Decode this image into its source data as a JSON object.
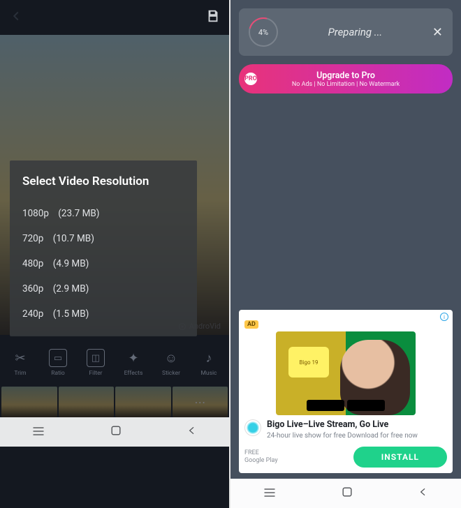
{
  "left": {
    "resolution_title": "Select Video Resolution",
    "options": [
      {
        "label": "1080p",
        "size": "(23.7 MB)"
      },
      {
        "label": "720p",
        "size": "(10.7 MB)"
      },
      {
        "label": "480p",
        "size": "(4.9 MB)"
      },
      {
        "label": "360p",
        "size": "(2.9 MB)"
      },
      {
        "label": "240p",
        "size": "(1.5 MB)"
      }
    ],
    "watermark": "AndroVid",
    "tools": [
      {
        "label": "Trim",
        "glyph": "✂"
      },
      {
        "label": "Ratio",
        "glyph": "▭"
      },
      {
        "label": "Filter",
        "glyph": "◫"
      },
      {
        "label": "Effects",
        "glyph": "✦"
      },
      {
        "label": "Sticker",
        "glyph": "☺"
      },
      {
        "label": "Music",
        "glyph": "♪"
      }
    ]
  },
  "right": {
    "progress_percent": "4%",
    "progress_label": "Preparing ...",
    "upgrade_badge": "PRO",
    "upgrade_title": "Upgrade to Pro",
    "upgrade_sub": "No Ads | No Limitation | No Watermark",
    "ad_tag": "AD",
    "ad_bubble": "Bigo 19",
    "ad_title": "Bigo Live–Live Stream, Go Live",
    "ad_sub": "24-hour live show for free Download for free now",
    "ad_src_line1": "FREE",
    "ad_src_line2": "Google Play",
    "install_label": "INSTALL"
  }
}
